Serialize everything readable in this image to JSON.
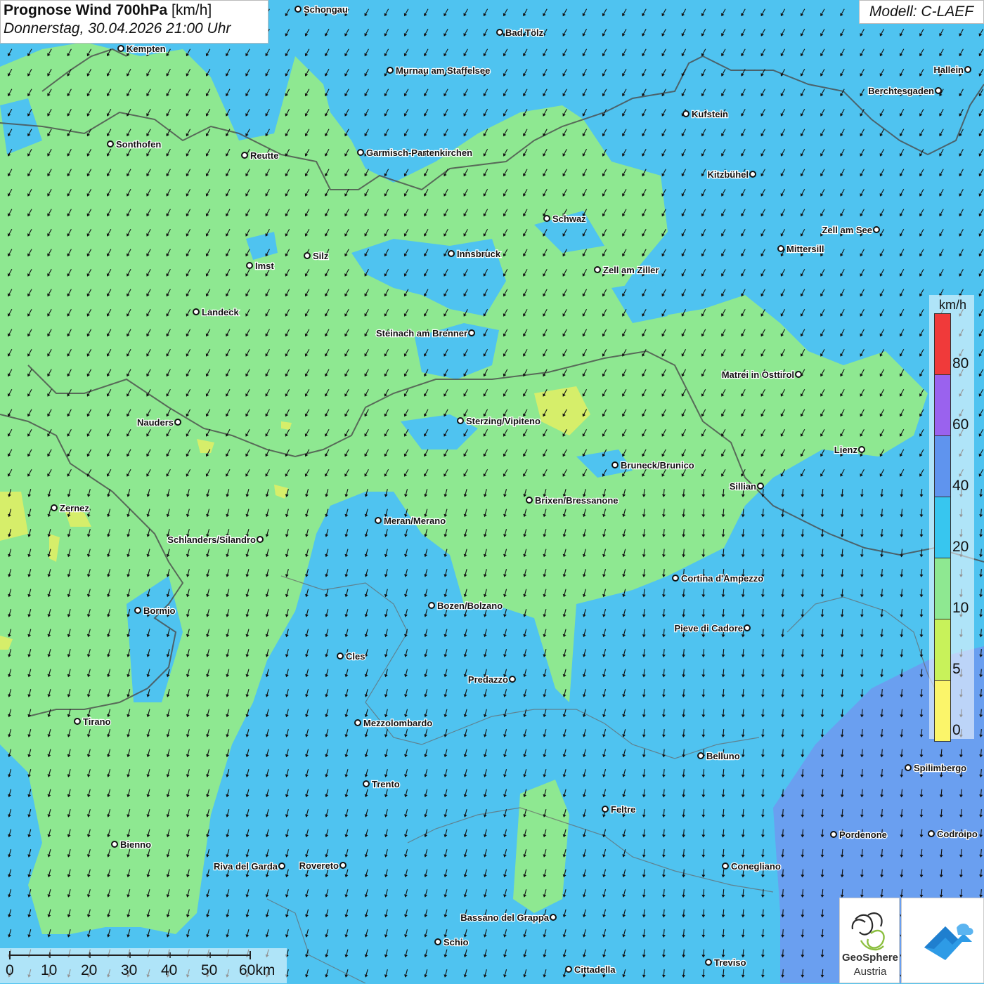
{
  "title": {
    "bold": "Prognose Wind 700hPa",
    "unit": " [km/h]",
    "date": "Donnerstag, 30.04.2026 21:00 Uhr"
  },
  "model": "Modell: C-LAEF",
  "legend": {
    "unit": "km/h",
    "bands": [
      {
        "value": "80",
        "color": "#f03a3a"
      },
      {
        "value": "60",
        "color": "#9a62ee"
      },
      {
        "value": "40",
        "color": "#5f94ee"
      },
      {
        "value": "20",
        "color": "#37c6ef"
      },
      {
        "value": "10",
        "color": "#8ee891"
      },
      {
        "value": "5",
        "color": "#c8f25a"
      },
      {
        "value": "0",
        "color": "#fbf56a"
      }
    ]
  },
  "scale_bar": [
    "0",
    "10",
    "20",
    "30",
    "40",
    "50",
    "60km"
  ],
  "logos": {
    "geosphere_line1": "GeoSphere",
    "geosphere_line2": "Austria"
  },
  "cities": [
    {
      "name": "Schongau",
      "label_side": "right"
    },
    {
      "name": "Bad Tölz",
      "label_side": "right"
    },
    {
      "name": "Kempten",
      "label_side": "right"
    },
    {
      "name": "Murnau am Staffelsee",
      "label_side": "right"
    },
    {
      "name": "Hallein",
      "label_side": "left"
    },
    {
      "name": "Berchtesgaden",
      "label_side": "left"
    },
    {
      "name": "Kufstein",
      "label_side": "right"
    },
    {
      "name": "Sonthofen",
      "label_side": "right"
    },
    {
      "name": "Reutte",
      "label_side": "right"
    },
    {
      "name": "Garmisch-Partenkirchen",
      "label_side": "right"
    },
    {
      "name": "Kitzbühel",
      "label_side": "left"
    },
    {
      "name": "Schwaz",
      "label_side": "right"
    },
    {
      "name": "Zell am See",
      "label_side": "left"
    },
    {
      "name": "Mittersill",
      "label_side": "right"
    },
    {
      "name": "Innsbruck",
      "label_side": "right"
    },
    {
      "name": "Silz",
      "label_side": "right"
    },
    {
      "name": "Imst",
      "label_side": "right"
    },
    {
      "name": "Zell am Ziller",
      "label_side": "right"
    },
    {
      "name": "Landeck",
      "label_side": "right"
    },
    {
      "name": "Steinach am Brenner",
      "label_side": "left"
    },
    {
      "name": "Matrei in Osttirol",
      "label_side": "left"
    },
    {
      "name": "Nauders",
      "label_side": "left"
    },
    {
      "name": "Sterzing/Vipiteno",
      "label_side": "right"
    },
    {
      "name": "Lienz",
      "label_side": "left"
    },
    {
      "name": "Bruneck/Brunico",
      "label_side": "right"
    },
    {
      "name": "Sillian",
      "label_side": "left"
    },
    {
      "name": "Zernez",
      "label_side": "right"
    },
    {
      "name": "Brixen/Bressanone",
      "label_side": "right"
    },
    {
      "name": "Meran/Merano",
      "label_side": "right"
    },
    {
      "name": "Schlanders/Silandro",
      "label_side": "left"
    },
    {
      "name": "Cortina d'Ampezzo",
      "label_side": "right"
    },
    {
      "name": "Bozen/Bolzano",
      "label_side": "right"
    },
    {
      "name": "Bormio",
      "label_side": "right"
    },
    {
      "name": "Pieve di Cadore",
      "label_side": "left"
    },
    {
      "name": "Cles",
      "label_side": "right"
    },
    {
      "name": "Predazzo",
      "label_side": "left"
    },
    {
      "name": "Tirano",
      "label_side": "right"
    },
    {
      "name": "Mezzolombardo",
      "label_side": "right"
    },
    {
      "name": "Belluno",
      "label_side": "right"
    },
    {
      "name": "Spilimbergo",
      "label_side": "right"
    },
    {
      "name": "Trento",
      "label_side": "right"
    },
    {
      "name": "Feltre",
      "label_side": "right"
    },
    {
      "name": "Pordenone",
      "label_side": "right"
    },
    {
      "name": "Codroipo",
      "label_side": "right"
    },
    {
      "name": "Bienno",
      "label_side": "right"
    },
    {
      "name": "Riva del Garda",
      "label_side": "left"
    },
    {
      "name": "Rovereto",
      "label_side": "left"
    },
    {
      "name": "Conegliano",
      "label_side": "right"
    },
    {
      "name": "Bassano del Grappa",
      "label_side": "left"
    },
    {
      "name": "Schio",
      "label_side": "right"
    },
    {
      "name": "Treviso",
      "label_side": "right"
    },
    {
      "name": "Cittadella",
      "label_side": "right"
    }
  ],
  "wind_field": {
    "direction": "from north-northeast",
    "colors": {
      "low": "#8ee891",
      "mid": "#4fc3f0",
      "high": "#6a9ff0",
      "calm": "#d6ee6a"
    }
  }
}
